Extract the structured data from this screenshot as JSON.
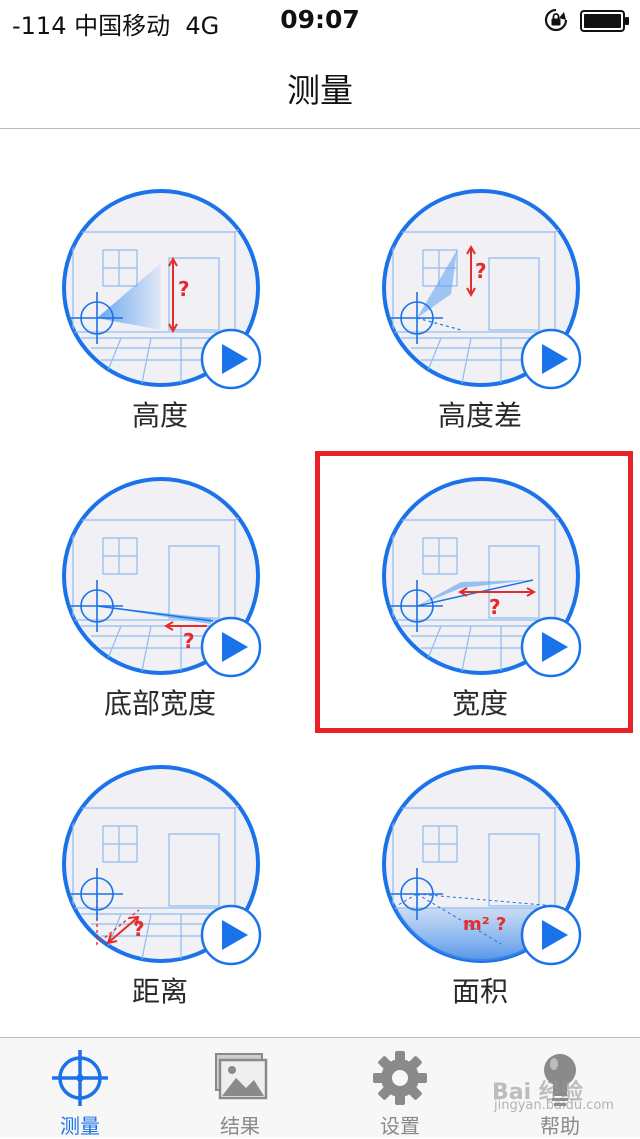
{
  "status_bar": {
    "signal_carrier": "-114 中国移动",
    "network": "4G",
    "time": "09:07",
    "rotation_lock_icon": "rotation-lock-icon",
    "battery_icon": "battery-icon"
  },
  "nav": {
    "title": "测量"
  },
  "measurements": [
    {
      "label": "高度",
      "icon": "height-measure-icon"
    },
    {
      "label": "高度差",
      "icon": "height-difference-icon"
    },
    {
      "label": "底部宽度",
      "icon": "bottom-width-icon"
    },
    {
      "label": "宽度",
      "icon": "width-measure-icon",
      "highlighted": true
    },
    {
      "label": "距离",
      "icon": "distance-measure-icon"
    },
    {
      "label": "面积",
      "icon": "area-measure-icon"
    }
  ],
  "tabs": [
    {
      "label": "测量",
      "icon": "crosshair-icon",
      "active": true
    },
    {
      "label": "结果",
      "icon": "photos-icon"
    },
    {
      "label": "设置",
      "icon": "gear-icon"
    },
    {
      "label": "帮助",
      "icon": "lightbulb-icon"
    }
  ],
  "watermark": {
    "text": "Bai 经验",
    "sub": "jingyan.baidu.com"
  },
  "colors": {
    "accent": "#1a73e8",
    "highlight": "#e8212b",
    "question": "#e52b2b"
  }
}
